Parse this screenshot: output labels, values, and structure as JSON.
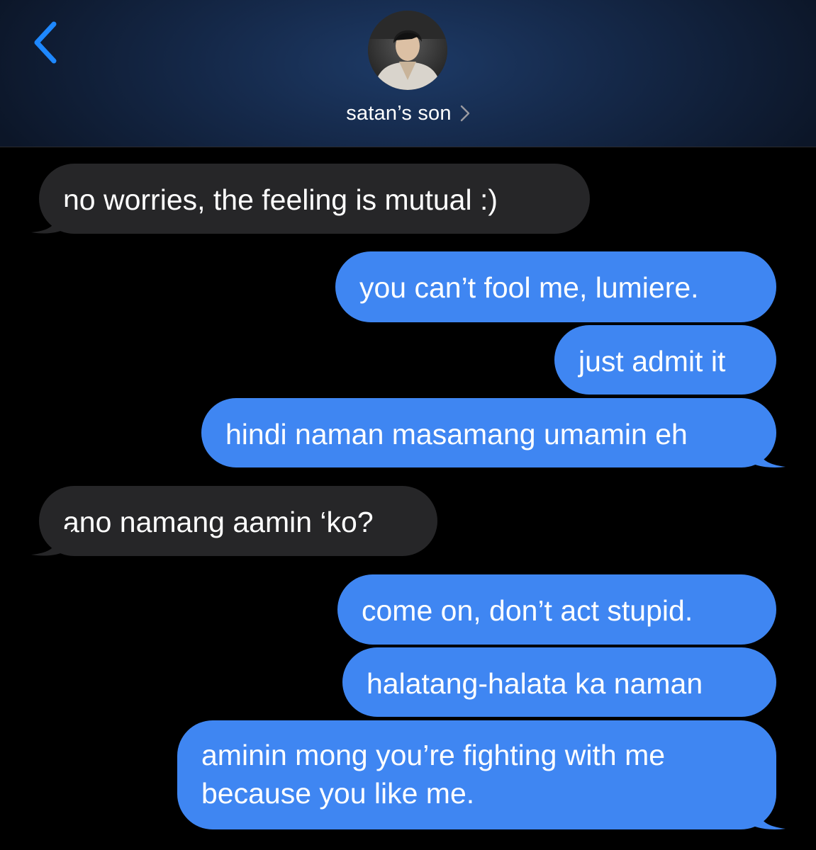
{
  "header": {
    "contact_name": "satan’s son",
    "back_icon": "chevron-left-icon",
    "avatar_icon": "contact-avatar",
    "disclosure_icon": "chevron-right-icon"
  },
  "colors": {
    "sent_bubble": "#3f86f2",
    "received_bubble": "#262628",
    "accent": "#1e88ff",
    "background": "#000000"
  },
  "messages": [
    {
      "direction": "received",
      "text": "no worries, the feeling is mutual :)"
    },
    {
      "direction": "sent",
      "text": "you can’t fool me, lumiere."
    },
    {
      "direction": "sent",
      "text": "just admit it"
    },
    {
      "direction": "sent",
      "text": "hindi naman masamang umamin eh"
    },
    {
      "direction": "received",
      "text": "ano namang aamin ‘ko?"
    },
    {
      "direction": "sent",
      "text": "come on, don’t act stupid."
    },
    {
      "direction": "sent",
      "text": "halatang-halata ka naman"
    },
    {
      "direction": "sent",
      "text": "aminin mong you’re fighting with me because you like me."
    }
  ]
}
